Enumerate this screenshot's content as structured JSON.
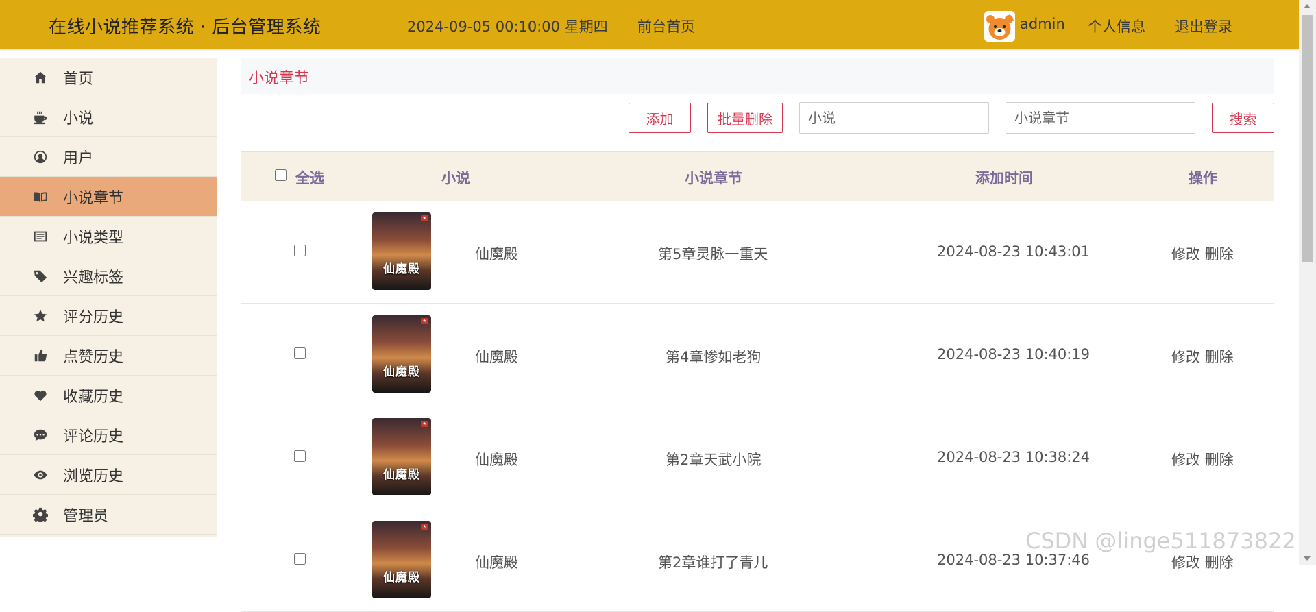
{
  "header": {
    "brand": "在线小说推荐系统 · 后台管理系统",
    "datetime": "2024-09-05  00:10:00  星期四",
    "front_link": "前台首页",
    "username": "admin",
    "profile": "个人信息",
    "logout": "退出登录"
  },
  "sidebar": {
    "items": [
      {
        "label": "首页",
        "icon": "home-icon"
      },
      {
        "label": "小说",
        "icon": "coffee-icon"
      },
      {
        "label": "用户",
        "icon": "user-circle-icon"
      },
      {
        "label": "小说章节",
        "icon": "book-open-icon"
      },
      {
        "label": "小说类型",
        "icon": "list-icon"
      },
      {
        "label": "兴趣标签",
        "icon": "tag-icon"
      },
      {
        "label": "评分历史",
        "icon": "star-icon"
      },
      {
        "label": "点赞历史",
        "icon": "thumbs-up-icon"
      },
      {
        "label": "收藏历史",
        "icon": "heart-icon"
      },
      {
        "label": "评论历史",
        "icon": "comment-icon"
      },
      {
        "label": "浏览历史",
        "icon": "eye-icon"
      },
      {
        "label": "管理员",
        "icon": "gear-icon"
      }
    ],
    "active_index": 3
  },
  "main": {
    "breadcrumb": "小说章节",
    "toolbar": {
      "add": "添加",
      "batch_delete": "批量删除",
      "novel_placeholder": "小说",
      "chapter_placeholder": "小说章节",
      "search": "搜索"
    },
    "table": {
      "headers": {
        "select_all": "全选",
        "novel": "小说",
        "chapter": "小说章节",
        "time": "添加时间",
        "action": "操作"
      },
      "rows": [
        {
          "cover_title": "仙魔殿",
          "novel": "仙魔殿",
          "chapter": "第5章灵脉一重天",
          "time": "2024-08-23 10:43:01",
          "edit": "修改",
          "delete": "删除"
        },
        {
          "cover_title": "仙魔殿",
          "novel": "仙魔殿",
          "chapter": "第4章惨如老狗",
          "time": "2024-08-23 10:40:19",
          "edit": "修改",
          "delete": "删除"
        },
        {
          "cover_title": "仙魔殿",
          "novel": "仙魔殿",
          "chapter": "第2章天武小院",
          "time": "2024-08-23 10:38:24",
          "edit": "修改",
          "delete": "删除"
        },
        {
          "cover_title": "仙魔殿",
          "novel": "仙魔殿",
          "chapter": "第2章谁打了青儿",
          "time": "2024-08-23 10:37:46",
          "edit": "修改",
          "delete": "删除"
        }
      ]
    }
  },
  "watermark": "CSDN @linge511873822",
  "colors": {
    "header_bg": "#ddaa10",
    "accent": "#d9374f",
    "active_nav": "#e9a97a",
    "sidebar_bg": "#f6f1e4"
  }
}
